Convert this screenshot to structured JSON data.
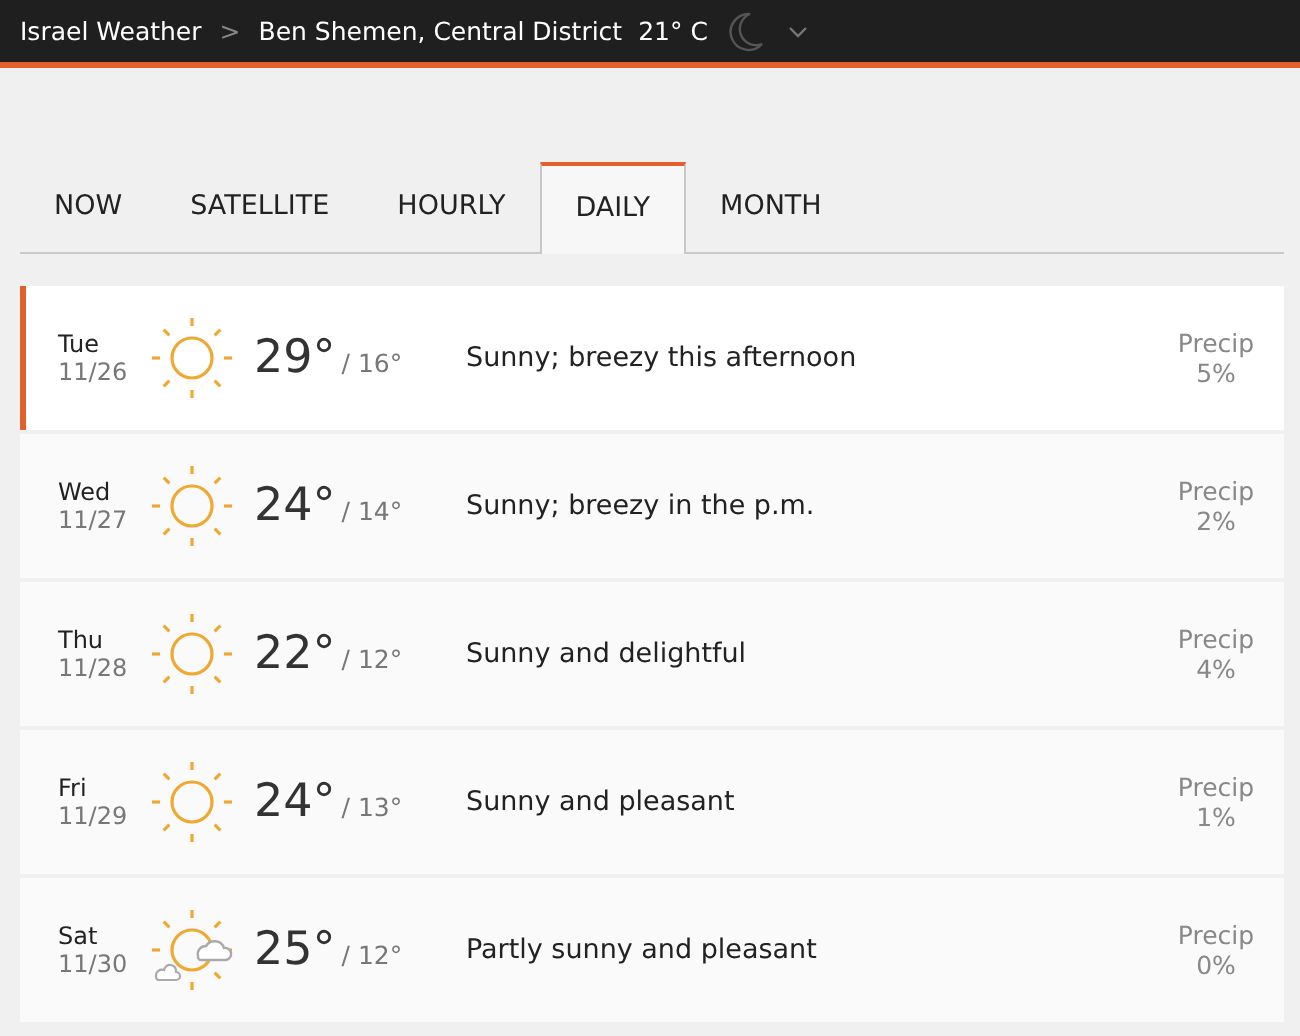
{
  "header": {
    "breadcrumb": "Israel Weather",
    "separator": ">",
    "location": "Ben Shemen, Central District",
    "temperature": "21° C"
  },
  "tabs": [
    {
      "label": "NOW",
      "selected": false
    },
    {
      "label": "SATELLITE",
      "selected": false
    },
    {
      "label": "HOURLY",
      "selected": false
    },
    {
      "label": "DAILY",
      "selected": true
    },
    {
      "label": "MONTH",
      "selected": false
    }
  ],
  "days": [
    {
      "day": "Tue",
      "date": "11/26",
      "kind": "sunny",
      "high": "29°",
      "low": "/ 16°",
      "phrase": "Sunny; breezy this afternoon",
      "precip_label": "Precip",
      "precip": "5%",
      "selected": true
    },
    {
      "day": "Wed",
      "date": "11/27",
      "kind": "sunny",
      "high": "24°",
      "low": "/ 14°",
      "phrase": "Sunny; breezy in the p.m.",
      "precip_label": "Precip",
      "precip": "2%",
      "selected": false
    },
    {
      "day": "Thu",
      "date": "11/28",
      "kind": "sunny",
      "high": "22°",
      "low": "/ 12°",
      "phrase": "Sunny and delightful",
      "precip_label": "Precip",
      "precip": "4%",
      "selected": false
    },
    {
      "day": "Fri",
      "date": "11/29",
      "kind": "sunny",
      "high": "24°",
      "low": "/ 13°",
      "phrase": "Sunny and pleasant",
      "precip_label": "Precip",
      "precip": "1%",
      "selected": false
    },
    {
      "day": "Sat",
      "date": "11/30",
      "kind": "partly-sunny",
      "high": "25°",
      "low": "/ 12°",
      "phrase": "Partly sunny and pleasant",
      "precip_label": "Precip",
      "precip": "0%",
      "selected": false
    }
  ]
}
